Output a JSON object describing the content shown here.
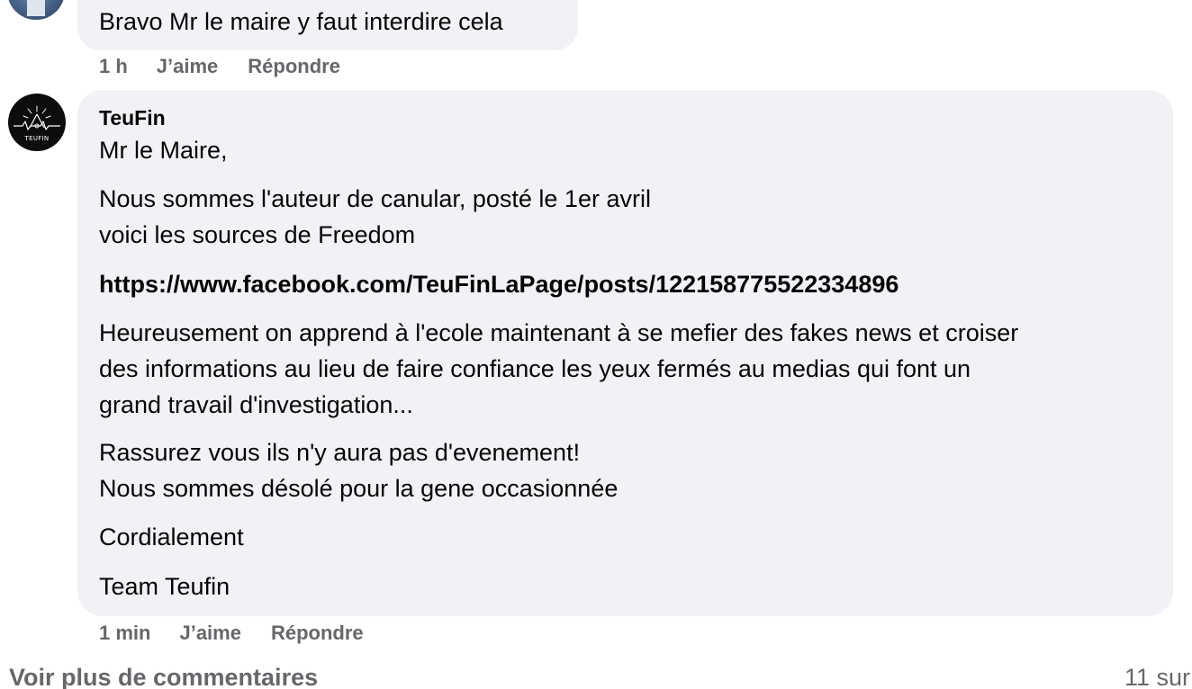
{
  "comments": [
    {
      "text": "Bravo Mr le maire y faut interdire cela",
      "time": "1 h",
      "like_label": "J’aime",
      "reply_label": "Répondre"
    },
    {
      "author": "TeuFin",
      "avatar_text": "TEUFIN",
      "lines": [
        "Mr le Maire,",
        "Nous sommes l'auteur de canular, posté le 1er avril",
        "voici les sources de Freedom",
        "https://www.facebook.com/TeuFinLaPage/posts/122158775522334896",
        "Heureusement on apprend à l'ecole maintenant à se mefier des fakes news et croiser",
        "des informations au lieu de faire confiance les yeux fermés au medias qui font un",
        "grand travail d'investigation...",
        "Rassurez vous ils n'y aura pas d'evenement!",
        "Nous sommes désolé pour la gene occasionnée",
        "Cordialement",
        "Team Teufin"
      ],
      "time": "1 min",
      "like_label": "J’aime",
      "reply_label": "Répondre"
    }
  ],
  "footer": {
    "more_comments_label": "Voir plus de commentaires",
    "count_label": "11 sur"
  },
  "colors": {
    "bubble": "#f0f2f5",
    "secondary_text": "#65676b",
    "primary_text": "#050505"
  }
}
